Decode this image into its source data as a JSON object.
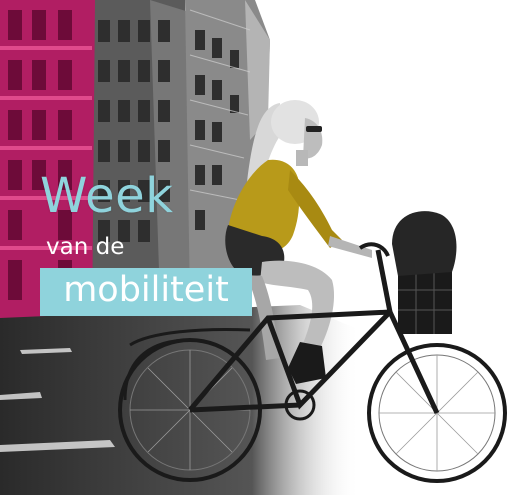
{
  "colors": {
    "accent": "#8fd3dc",
    "magenta": "#b11e63",
    "jacket": "#b89a1a",
    "white": "#ffffff"
  },
  "poster": {
    "title_line1": "Week",
    "title_line2": "van de",
    "title_line3": "mobiliteit"
  },
  "icons": [
    "bicycle-icon"
  ]
}
